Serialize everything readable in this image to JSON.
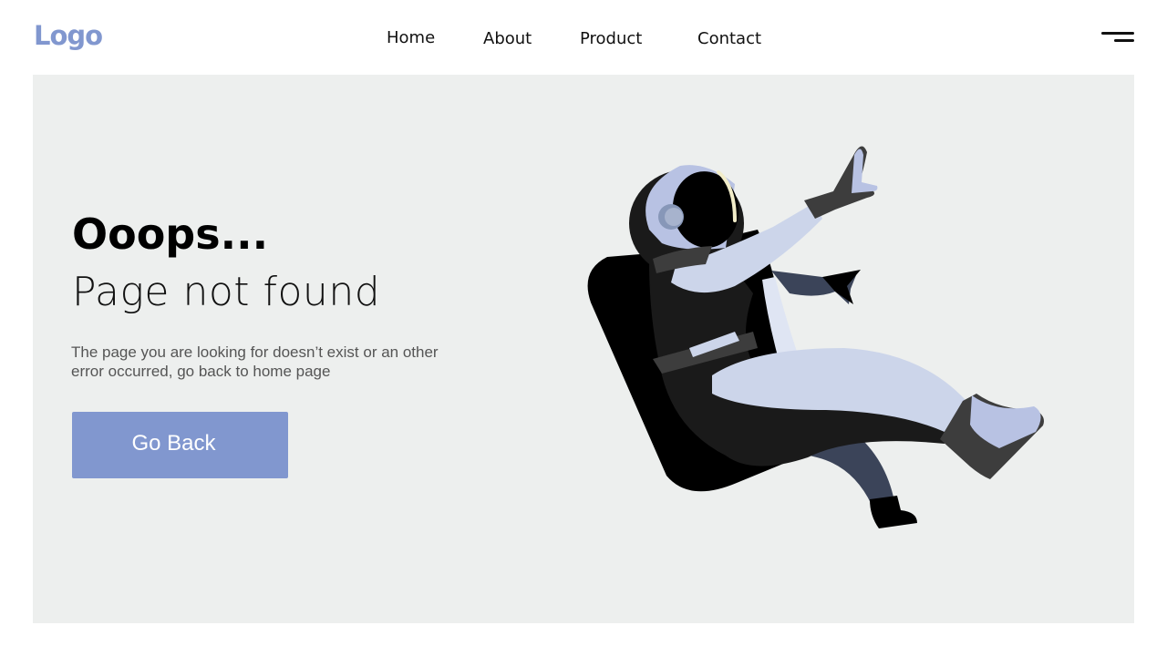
{
  "header": {
    "logo": "Logo",
    "nav": [
      {
        "label": "Home"
      },
      {
        "label": "About"
      },
      {
        "label": "Product"
      },
      {
        "label": "Contact"
      }
    ],
    "menu_icon": "hamburger-menu-icon"
  },
  "main": {
    "headline": "Ooops...",
    "subheadline": "Page not found",
    "description": "The page you are looking for doesn’t exist or an other error occurred, go back to home page",
    "button_label": "Go Back",
    "illustration": "floating-astronaut-in-chair"
  },
  "colors": {
    "accent": "#8197cf",
    "background": "#edefee",
    "suit_light": "#ccd5ea",
    "suit_dark": "#1a1a1a",
    "leg_dark": "#3b4459"
  }
}
